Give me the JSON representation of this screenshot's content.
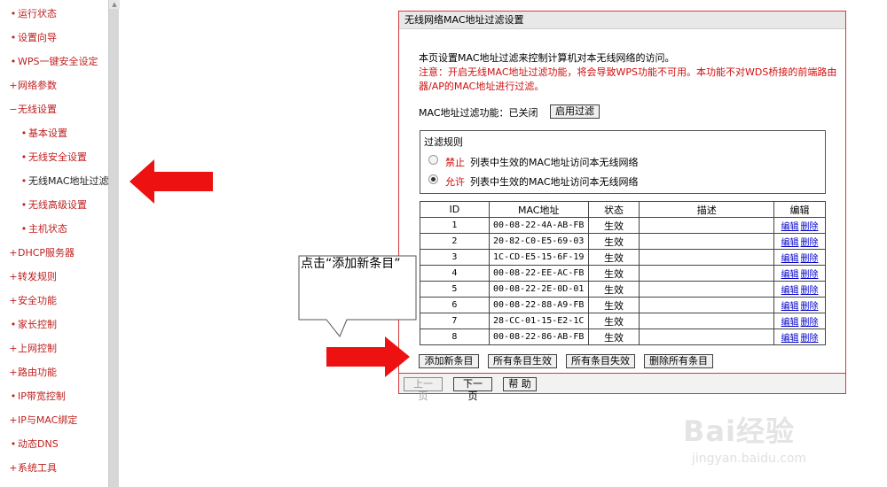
{
  "sidebar": {
    "items": [
      {
        "marker": "•",
        "label": "运行状态"
      },
      {
        "marker": "•",
        "label": "设置向导"
      },
      {
        "marker": "•",
        "label": "WPS一键安全设定"
      },
      {
        "marker": "+",
        "label": "网络参数"
      },
      {
        "marker": "−",
        "label": "无线设置"
      },
      {
        "marker": "•",
        "label": "基本设置"
      },
      {
        "marker": "•",
        "label": "无线安全设置"
      },
      {
        "marker": "•",
        "label": "无线MAC地址过滤"
      },
      {
        "marker": "•",
        "label": "无线高级设置"
      },
      {
        "marker": "•",
        "label": "主机状态"
      },
      {
        "marker": "+",
        "label": "DHCP服务器"
      },
      {
        "marker": "+",
        "label": "转发规则"
      },
      {
        "marker": "+",
        "label": "安全功能"
      },
      {
        "marker": "•",
        "label": "家长控制"
      },
      {
        "marker": "+",
        "label": "上网控制"
      },
      {
        "marker": "+",
        "label": "路由功能"
      },
      {
        "marker": "•",
        "label": "IP带宽控制"
      },
      {
        "marker": "+",
        "label": "IP与MAC绑定"
      },
      {
        "marker": "•",
        "label": "动态DNS"
      },
      {
        "marker": "+",
        "label": "系统工具"
      }
    ]
  },
  "panel": {
    "title": "无线网络MAC地址过滤设置",
    "intro": "本页设置MAC地址过滤来控制计算机对本无线网络的访问。",
    "note_line1": "注意：开启无线MAC地址过滤功能，将会导致WPS功能不可用。本功能不对WDS桥接的前端路由",
    "note_line2": "器/AP的MAC地址进行过滤。",
    "filter_status_label": "MAC地址过滤功能：已关闭",
    "enable_button": "启用过滤",
    "rules_title": "过滤规则",
    "rule_deny_key": "禁止",
    "rule_deny_text": "列表中生效的MAC地址访问本无线网络",
    "rule_allow_key": "允许",
    "rule_allow_text": "列表中生效的MAC地址访问本无线网络",
    "table": {
      "headers": [
        "ID",
        "MAC地址",
        "状态",
        "描述",
        "编辑"
      ],
      "edit_label": "编辑",
      "delete_label": "删除",
      "rows": [
        {
          "id": "1",
          "mac": "00-08-22-4A-AB-FB",
          "status": "生效",
          "desc": ""
        },
        {
          "id": "2",
          "mac": "20-82-C0-E5-69-03",
          "status": "生效",
          "desc": ""
        },
        {
          "id": "3",
          "mac": "1C-CD-E5-15-6F-19",
          "status": "生效",
          "desc": ""
        },
        {
          "id": "4",
          "mac": "00-08-22-EE-AC-FB",
          "status": "生效",
          "desc": ""
        },
        {
          "id": "5",
          "mac": "00-08-22-2E-0D-01",
          "status": "生效",
          "desc": ""
        },
        {
          "id": "6",
          "mac": "00-08-22-88-A9-FB",
          "status": "生效",
          "desc": ""
        },
        {
          "id": "7",
          "mac": "28-CC-01-15-E2-1C",
          "status": "生效",
          "desc": ""
        },
        {
          "id": "8",
          "mac": "00-08-22-86-AB-FB",
          "status": "生效",
          "desc": ""
        }
      ]
    },
    "actions": {
      "add": "添加新条目",
      "enable_all": "所有条目生效",
      "disable_all": "所有条目失效",
      "delete_all": "删除所有条目"
    },
    "nav": {
      "prev": "上一页",
      "next": "下一页",
      "help": "帮 助"
    }
  },
  "annotation": {
    "callout": "点击“添加新条目”",
    "arrow_color": "#ee1111"
  },
  "watermark": {
    "logo": "Bai经验",
    "url": "jingyan.baidu.com"
  }
}
